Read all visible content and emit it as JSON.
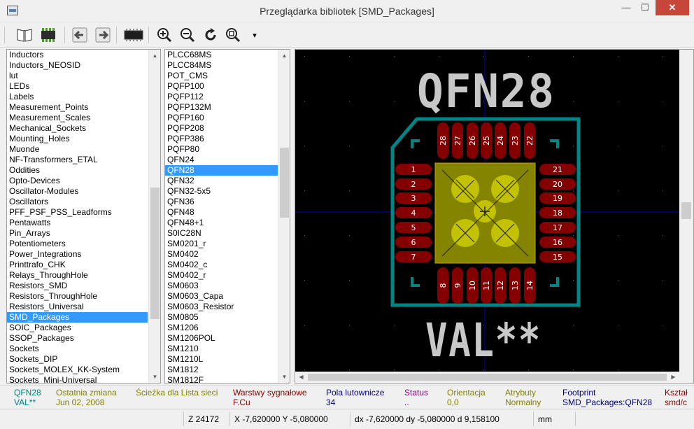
{
  "window": {
    "title": "Przeglądarka bibliotek [SMD_Packages]",
    "minimize": "—",
    "maximize": "☐",
    "close": "✕"
  },
  "toolbar": {
    "buttons": [
      "library-icon",
      "component-icon",
      "previous-icon",
      "next-icon",
      "show-3d-icon",
      "zoom-in-icon",
      "zoom-out-icon",
      "redraw-icon",
      "zoom-auto-icon"
    ],
    "more": "▾"
  },
  "libraries": {
    "items": [
      "Inductors",
      "Inductors_NEOSID",
      "lut",
      "LEDs",
      "Labels",
      "Measurement_Points",
      "Measurement_Scales",
      "Mechanical_Sockets",
      "Mounting_Holes",
      "Muonde",
      "NF-Transformers_ETAL",
      "Oddities",
      "Opto-Devices",
      "Oscillator-Modules",
      "Oscillators",
      "PFF_PSF_PSS_Leadforms",
      "Pentawatts",
      "Pin_Arrays",
      "Potentiometers",
      "Power_Integrations",
      "Printtrafo_CHK",
      "Relays_ThroughHole",
      "Resistors_SMD",
      "Resistors_ThroughHole",
      "Resistors_Universal",
      "SMD_Packages",
      "SOIC_Packages",
      "SSOP_Packages",
      "Sockets",
      "Sockets_DIP",
      "Sockets_MOLEX_KK-System",
      "Sockets_Mini-Universal"
    ],
    "selected": "SMD_Packages"
  },
  "footprints": {
    "items": [
      "PLCC68MS",
      "PLCC84MS",
      "POT_CMS",
      "PQFP100",
      "PQFP112",
      "PQFP132M",
      "PQFP160",
      "PQFP208",
      "PQFP386",
      "PQFP80",
      "QFN24",
      "QFN28",
      "QFN32",
      "QFN32-5x5",
      "QFN36",
      "QFN48",
      "QFN48+1",
      "S0IC28N",
      "SM0201_r",
      "SM0402",
      "SM0402_c",
      "SM0402_r",
      "SM0603",
      "SM0603_Capa",
      "SM0603_Resistor",
      "SM0805",
      "SM1206",
      "SM1206POL",
      "SM1210",
      "SM1210L",
      "SM1812",
      "SM1812F"
    ],
    "selected": "QFN28"
  },
  "preview": {
    "reference": "QFN28",
    "value": "VAL**",
    "left_pads": [
      "1",
      "2",
      "3",
      "4",
      "5",
      "6",
      "7"
    ],
    "bottom_pads": [
      "8",
      "9",
      "10",
      "11",
      "12",
      "13",
      "14"
    ],
    "right_pads": [
      "15",
      "16",
      "17",
      "18",
      "19",
      "20",
      "21"
    ],
    "top_pads": [
      "22",
      "23",
      "24",
      "25",
      "26",
      "27",
      "28"
    ],
    "colors": {
      "background": "#000000",
      "silkscreen": "#c8c8c8",
      "outline": "#008484",
      "pad": "#840000",
      "thermal_pad": "#848400",
      "paste": "#c2c200",
      "axis": "#0000c2"
    }
  },
  "info": {
    "name": {
      "label": "QFN28",
      "value": "VAL**",
      "color": "#008080"
    },
    "last_change": {
      "label": "Ostatnia zmiana",
      "value": "Jun 02, 2008",
      "color": "#808000"
    },
    "path": {
      "label": "Ścieżka dla Lista sieci",
      "value": "",
      "color": "#808000"
    },
    "layers": {
      "label": "Warstwy sygnałowe",
      "value": "F.Cu",
      "color": "#800000"
    },
    "pads": {
      "label": "Pola lutownicze",
      "value": "34",
      "color": "#000080"
    },
    "status": {
      "label": "Status",
      "value": "..",
      "color": "#800080"
    },
    "orientation": {
      "label": "Orientacja",
      "value": "0,0",
      "color": "#808000"
    },
    "attributes": {
      "label": "Atrybuty",
      "value": "Normalny",
      "color": "#808000"
    },
    "footprint": {
      "label": "Footprint",
      "value": "SMD_Packages:QFN28",
      "color": "#000080"
    },
    "shape": {
      "label": "Kształ",
      "value": "smd/c",
      "color": "#800000"
    }
  },
  "status": {
    "zoom": "Z 24172",
    "xy": "X -7,620000  Y -5,080000",
    "dxdy": "dx -7,620000  dy -5,080000  d 9,158100",
    "units": "mm"
  }
}
